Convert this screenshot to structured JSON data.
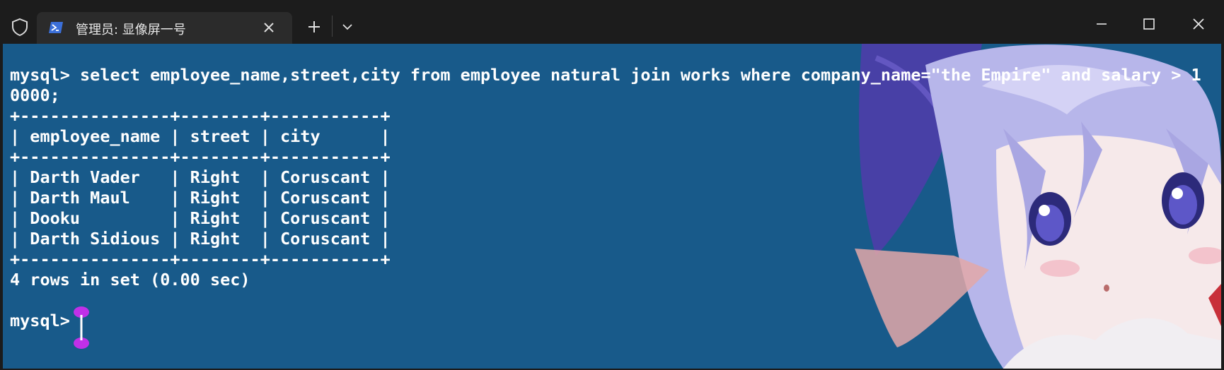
{
  "window": {
    "tab_title": "管理员: 显像屏一号",
    "accent_color": "#3b6fd8",
    "icons": [
      "shield-icon",
      "powershell-icon",
      "close-tab-icon",
      "plus-icon",
      "chevron-down-icon",
      "minimize-icon",
      "maximize-icon",
      "close-window-icon"
    ]
  },
  "terminal": {
    "background_color": "#185a8a",
    "text_color": "#ffffff",
    "lines": [
      "mysql> select employee_name,street,city from employee natural join works where company_name=\"the Empire\" and salary > 1",
      "0000;",
      "+---------------+--------+-----------+",
      "| employee_name | street | city      |",
      "+---------------+--------+-----------+",
      "| Darth Vader   | Right  | Coruscant |",
      "| Darth Maul    | Right  | Coruscant |",
      "| Dooku         | Right  | Coruscant |",
      "| Darth Sidious | Right  | Coruscant |",
      "+---------------+--------+-----------+",
      "4 rows in set (0.00 sec)",
      "",
      "mysql> "
    ],
    "cursor_color": "#c030e8"
  }
}
